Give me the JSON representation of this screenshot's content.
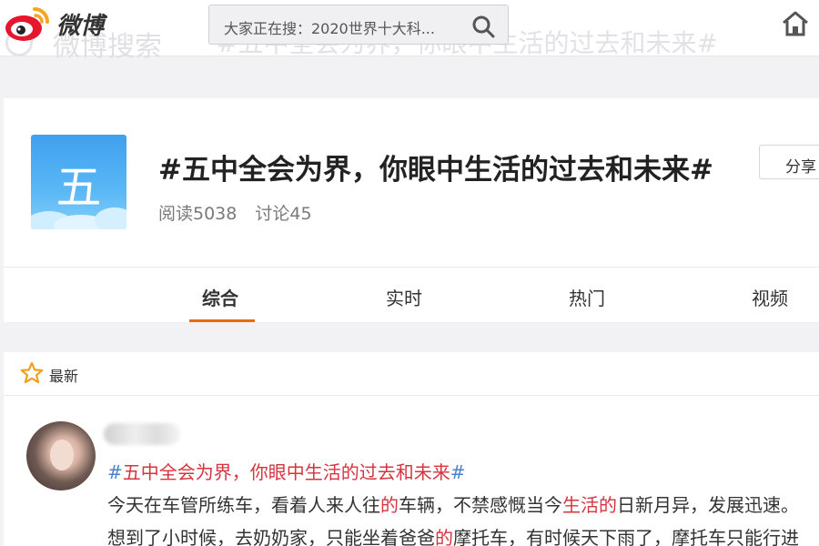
{
  "topbar": {
    "logo_text": "微博",
    "ghost_left": "微博搜索",
    "ghost_right": "#五中全会为界，你眼中生活的过去和未来#",
    "search_text": "大家正在搜：2020世界十大科..."
  },
  "topic": {
    "logo_char": "五",
    "title": "#五中全会为界，你眼中生活的过去和未来#",
    "reads": "阅读5038",
    "discussions": "讨论45",
    "share_label": "分享"
  },
  "tabs": [
    {
      "label": "综合"
    },
    {
      "label": "实时"
    },
    {
      "label": "热门"
    },
    {
      "label": "视频"
    }
  ],
  "feed": {
    "header_label": "最新",
    "post": {
      "topic_hash_open": "#",
      "topic_text": "五中全会为界，你眼中生活的过去和未来",
      "topic_hash_close": "#",
      "line1_a": "今天在车管所练车，看着人来人往",
      "line1_b": "的",
      "line1_c": "车辆，不禁感慨当今",
      "line1_d": "生活的",
      "line1_e": "日新月异，发展迅速。",
      "line2_a": "想到了小时候，去奶奶家，只能坐着爸爸",
      "line2_b": "的",
      "line2_c": "摩托车，有时候天下雨了，摩托车只能行进"
    }
  },
  "colors": {
    "accent": "#e86b0c",
    "link_blue": "#4a83c9",
    "highlight_red": "#d6343f",
    "weibo_red": "#e6162d"
  }
}
